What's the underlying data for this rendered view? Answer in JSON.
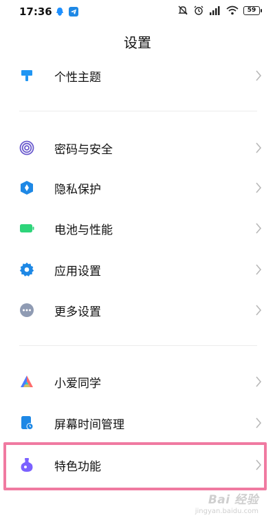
{
  "status_bar": {
    "time": "17:36",
    "battery": "59",
    "app_icons": [
      "qq-icon",
      "telegram-icon"
    ],
    "system_icons": [
      "mute-icon",
      "alarm-icon",
      "signal-icon",
      "wifi-icon",
      "battery-icon"
    ]
  },
  "page": {
    "title": "设置"
  },
  "settings": {
    "theme": {
      "label": "个性主题",
      "icon": "brush-icon",
      "color": "#2196f3"
    },
    "password": {
      "label": "密码与安全",
      "icon": "fingerprint-icon",
      "color": "#6a5acd"
    },
    "privacy": {
      "label": "隐私保护",
      "icon": "privacy-shield-icon",
      "color": "#1e88e5"
    },
    "battery": {
      "label": "电池与性能",
      "icon": "battery-icon",
      "color": "#2ed47a"
    },
    "apps": {
      "label": "应用设置",
      "icon": "gear-icon",
      "color": "#1e88e5"
    },
    "more": {
      "label": "更多设置",
      "icon": "more-dots-icon",
      "color": "#8f9bb3"
    },
    "xiaoai": {
      "label": "小爱同学",
      "icon": "xiaoai-icon",
      "color": "#ff6b6b"
    },
    "screen_time": {
      "label": "屏幕时间管理",
      "icon": "screen-time-icon",
      "color": "#1e88e5"
    },
    "special": {
      "label": "特色功能",
      "icon": "potion-icon",
      "color": "#7b61ff"
    }
  },
  "watermark": {
    "brand": "Bai 经验",
    "sub": "jingyan.baidu.com"
  }
}
